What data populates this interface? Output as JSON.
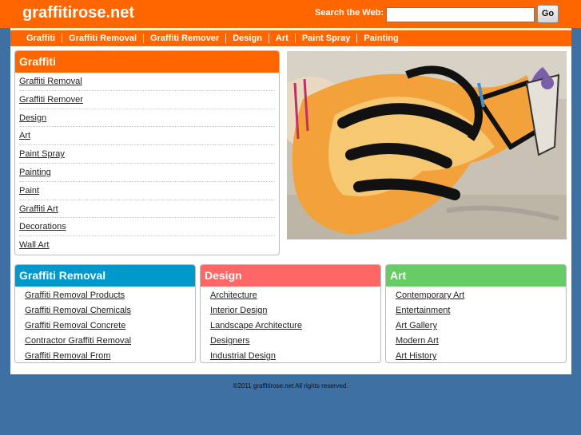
{
  "site": {
    "logo": "graffitirose.net",
    "search_label": "Search the Web:",
    "search_value": "",
    "go_label": "Go"
  },
  "nav": [
    "Graffiti",
    "Graffiti Removal",
    "Graffiti Remover",
    "Design",
    "Art",
    "Paint Spray",
    "Painting"
  ],
  "sidebar": {
    "title": "Graffiti",
    "items": [
      "Graffiti Removal",
      "Graffiti Remover",
      "Design",
      "Art",
      "Paint Spray",
      "Painting",
      "Paint",
      "Graffiti Art",
      "Decorations",
      "Wall Art"
    ]
  },
  "boxes": [
    {
      "title": "Graffiti Removal",
      "color": "#0099cc",
      "items": [
        "Graffiti Removal Products",
        "Graffiti Removal Chemicals",
        "Graffiti Removal Concrete",
        "Contractor Graffiti Removal",
        "Graffiti Removal From"
      ]
    },
    {
      "title": "Design",
      "color": "#ff6666",
      "items": [
        "Architecture",
        "Interior Design",
        "Landscape Architecture",
        "Designers",
        "Industrial Design"
      ]
    },
    {
      "title": "Art",
      "color": "#66cc66",
      "items": [
        "Contemporary Art",
        "Entertainment",
        "Art Gallery",
        "Modern Art",
        "Art History"
      ]
    }
  ],
  "footer": "©2011 graffitirose.net All rights reserved.",
  "colors": {
    "header": "#ff6600",
    "background": "#3e70a4"
  }
}
